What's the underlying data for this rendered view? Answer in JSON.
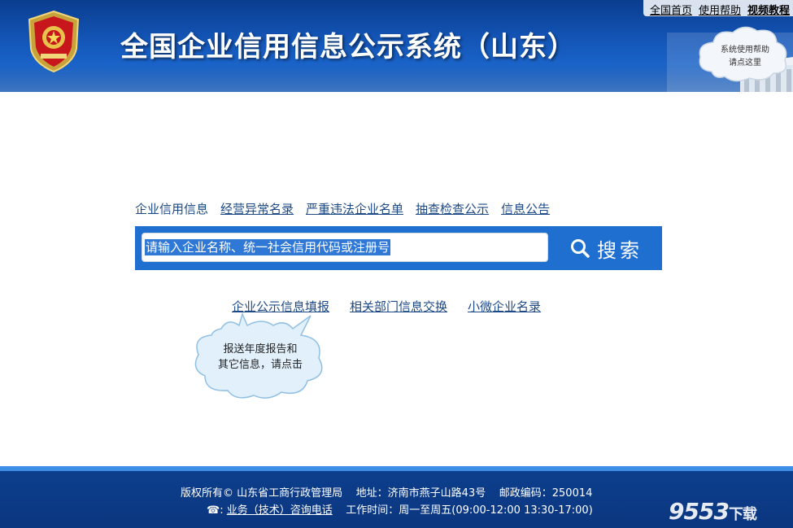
{
  "header": {
    "title": "全国企业信用信息公示系统（山东）",
    "emblem_icon": "national-emblem-badge-icon",
    "top_links": [
      "全国首页",
      "使用帮助",
      "视频教程"
    ],
    "help_cloud": {
      "line1": "系统使用帮助",
      "line2": "请点这里"
    }
  },
  "nav": {
    "items": [
      "企业信用信息",
      "经营异常名录",
      "严重违法企业名单",
      "抽查检查公示",
      "信息公告"
    ]
  },
  "search": {
    "placeholder": "请输入企业名称、统一社会信用代码或注册号",
    "button_label": "搜索",
    "button_icon": "search-icon"
  },
  "sub_links": [
    "企业公示信息填报",
    "相关部门信息交换",
    "小微企业名录"
  ],
  "tip_cloud": {
    "line1": "报送年度报告和",
    "line2": "其它信息，请点击"
  },
  "footer": {
    "copyright": "版权所有© 山东省工商行政管理局",
    "address": "地址：济南市燕子山路43号",
    "postcode": "邮政编码：250014",
    "phone_icon": "☎:",
    "phone_link": "业务（技术）咨询电话",
    "hours": "工作时间：周一至周五(09:00-12:00 13:30-17:00)"
  },
  "watermark": {
    "number": "9553",
    "suffix": "下载"
  },
  "colors": {
    "header_blue": "#1456b8",
    "search_blue": "#1f6fd1",
    "link_blue": "#1d4a86",
    "footer_blue": "#0d3f8c"
  }
}
